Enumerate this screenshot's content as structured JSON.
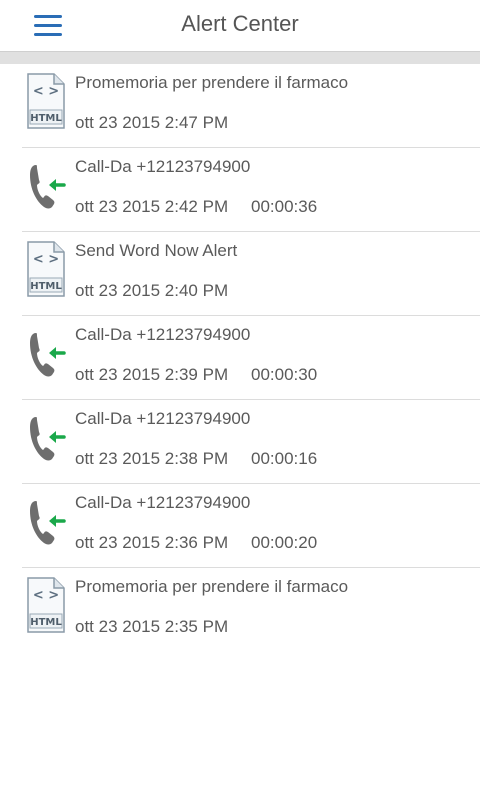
{
  "header": {
    "title": "Alert Center",
    "menu_icon": "hamburger-menu-icon",
    "accent_color": "#2a6db6"
  },
  "alerts": [
    {
      "type": "html",
      "icon": "html-file-icon",
      "icon_text": "HTML",
      "title": "Promemoria per prendere il farmaco",
      "date": "ott 23 2015 2:47 PM",
      "duration": ""
    },
    {
      "type": "call",
      "icon": "incoming-call-icon",
      "title": "Call-Da +12123794900",
      "date": "ott 23 2015 2:42 PM",
      "duration": "00:00:36"
    },
    {
      "type": "html",
      "icon": "html-file-icon",
      "icon_text": "HTML",
      "title": "Send Word Now Alert",
      "date": "ott 23 2015 2:40 PM",
      "duration": ""
    },
    {
      "type": "call",
      "icon": "incoming-call-icon",
      "title": "Call-Da +12123794900",
      "date": "ott 23 2015 2:39 PM",
      "duration": "00:00:30"
    },
    {
      "type": "call",
      "icon": "incoming-call-icon",
      "title": "Call-Da +12123794900",
      "date": "ott 23 2015 2:38 PM",
      "duration": "00:00:16"
    },
    {
      "type": "call",
      "icon": "incoming-call-icon",
      "title": "Call-Da +12123794900",
      "date": "ott 23 2015 2:36 PM",
      "duration": "00:00:20"
    },
    {
      "type": "html",
      "icon": "html-file-icon",
      "icon_text": "HTML",
      "title": "Promemoria per prendere il farmaco",
      "date": "ott 23 2015 2:35 PM",
      "duration": ""
    }
  ],
  "colors": {
    "call_arrow": "#1aa84a",
    "phone_handset": "#6e6e6e",
    "file_outline": "#8a9aa8"
  }
}
